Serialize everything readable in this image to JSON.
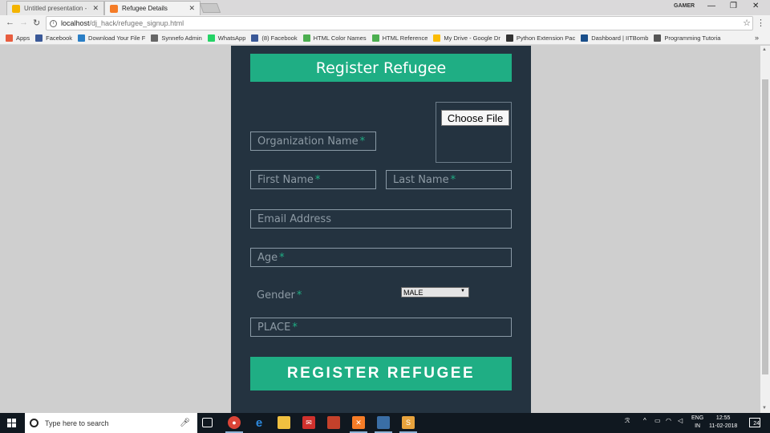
{
  "browser": {
    "tabs": [
      {
        "label": "Untitled presentation - G",
        "active": false,
        "color": "#f4b400"
      },
      {
        "label": "Refugee Details",
        "active": true,
        "color": "#f57c27"
      }
    ],
    "user": "GAMER",
    "url_host": "localhost",
    "url_path": "/dj_hack/refugee_signup.html",
    "bookmarks": [
      {
        "label": "Apps",
        "icon": "apps-icon",
        "color": "#e85d3f"
      },
      {
        "label": "Facebook",
        "icon": "facebook-icon",
        "color": "#3b5998"
      },
      {
        "label": "Download Your File F",
        "icon": "download-icon",
        "color": "#2a7fc6"
      },
      {
        "label": "Synnefo Admin",
        "icon": "synnefo-icon",
        "color": "#666666"
      },
      {
        "label": "WhatsApp",
        "icon": "whatsapp-icon",
        "color": "#25d366"
      },
      {
        "label": "(8) Facebook",
        "icon": "facebook-icon",
        "color": "#3b5998"
      },
      {
        "label": "HTML Color Names",
        "icon": "w3-icon",
        "color": "#4caf50"
      },
      {
        "label": "HTML Reference",
        "icon": "w3-icon",
        "color": "#4caf50"
      },
      {
        "label": "My Drive - Google Dr",
        "icon": "drive-icon",
        "color": "#fbbc05"
      },
      {
        "label": "Python Extension Pac",
        "icon": "lfd-icon",
        "color": "#333333"
      },
      {
        "label": "Dashboard | IITBomb",
        "icon": "dashboard-icon",
        "color": "#1a4f8b"
      },
      {
        "label": "Programming Tutoria",
        "icon": "tutorial-icon",
        "color": "#555555"
      }
    ]
  },
  "form": {
    "title": "Register Refugee",
    "choose_file": "Choose File",
    "org_name": "Organization Name",
    "first_name": "First Name",
    "last_name": "Last Name",
    "email": "Email Address",
    "age": "Age",
    "gender_label": "Gender",
    "gender_value": "MALE",
    "place": "PLACE",
    "required_mark": "*",
    "submit": "REGISTER REFUGEE"
  },
  "taskbar": {
    "search_placeholder": "Type here to search",
    "lang": "ENG",
    "region": "IN",
    "time": "12:55",
    "date": "11-02-2018",
    "notifications": "24"
  },
  "colors": {
    "accent": "#1fae84",
    "panel": "#243340"
  }
}
